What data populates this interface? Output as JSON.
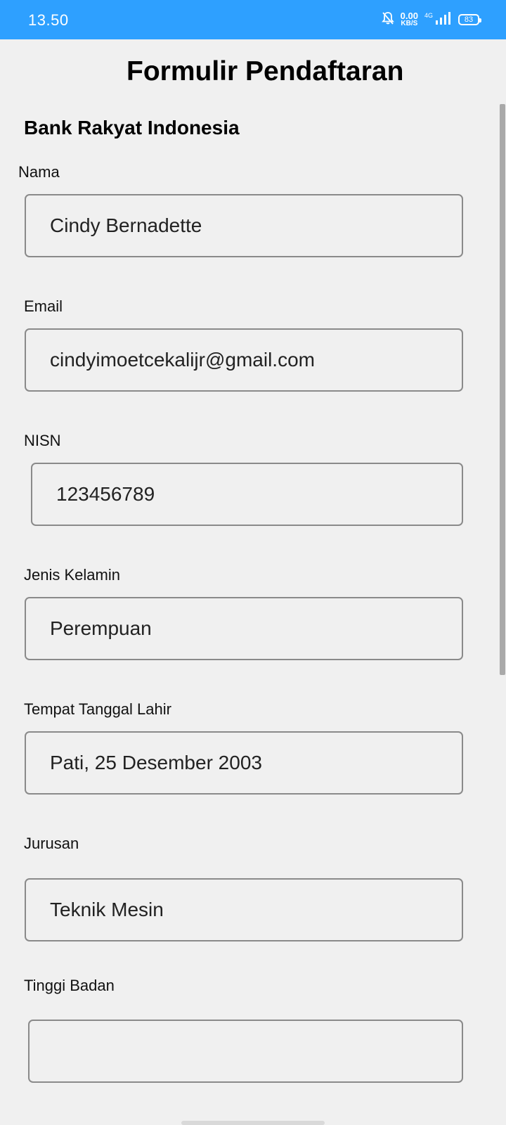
{
  "status_bar": {
    "time": "13.50",
    "net_speed_value": "0.00",
    "net_speed_unit": "KB/S",
    "network_type": "4G",
    "battery": "83"
  },
  "header": {
    "title": "Formulir Pendaftaran",
    "subtitle": "Bank Rakyat Indonesia"
  },
  "form": {
    "nama": {
      "label": "Nama",
      "value": "Cindy Bernadette"
    },
    "email": {
      "label": "Email",
      "value": "cindyimoetcekalijr@gmail.com"
    },
    "nisn": {
      "label": "NISN",
      "value": "123456789"
    },
    "jenis_kelamin": {
      "label": "Jenis Kelamin",
      "value": "Perempuan"
    },
    "ttl": {
      "label": "Tempat Tanggal Lahir",
      "value": "Pati, 25 Desember 2003"
    },
    "jurusan": {
      "label": "Jurusan",
      "value": "Teknik Mesin"
    },
    "tinggi_badan": {
      "label": "Tinggi Badan",
      "value": ""
    }
  },
  "colors": {
    "status_bar_bg": "#2ea0ff",
    "page_bg": "#f0f0f0",
    "field_border": "#8a8a8a"
  }
}
